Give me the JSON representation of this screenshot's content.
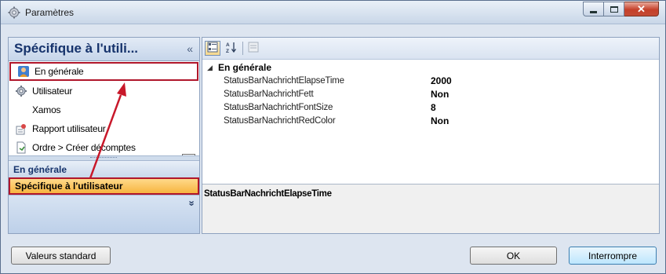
{
  "window": {
    "title": "Paramètres",
    "minimize_glyph": "–",
    "maximize_glyph": "□",
    "close_glyph": "✕"
  },
  "nav": {
    "header_title": "Spécifique à l'utili...",
    "collapse_glyph": "«",
    "items": [
      {
        "label": "En générale",
        "icon": "user-general-icon",
        "selected": true
      },
      {
        "label": "Utilisateur",
        "icon": "gear-icon",
        "selected": false
      },
      {
        "label": "Xamos",
        "icon": "",
        "selected": false
      },
      {
        "label": "Rapport utilisateur",
        "icon": "report-user-icon",
        "selected": false
      },
      {
        "label": "Ordre > Créer décomptes",
        "icon": "document-icon",
        "selected": false
      }
    ],
    "sections": [
      {
        "label": "En générale",
        "active": false
      },
      {
        "label": "Spécifique à l'utilisateur",
        "active": true
      }
    ],
    "overflow_glyph": "»"
  },
  "propgrid": {
    "category": "En générale",
    "rows": [
      {
        "name": "StatusBarNachrichtElapseTime",
        "value": "2000"
      },
      {
        "name": "StatusBarNachrichtFett",
        "value": "Non"
      },
      {
        "name": "StatusBarNachrichtFontSize",
        "value": "8"
      },
      {
        "name": "StatusBarNachrichtRedColor",
        "value": "Non"
      }
    ],
    "description_title": "StatusBarNachrichtElapseTime"
  },
  "footer": {
    "defaults_label": "Valeurs standard",
    "ok_label": "OK",
    "cancel_label": "Interrompre"
  },
  "colors": {
    "highlight_border": "#b0162b",
    "active_section": "#f7b540",
    "accent_text": "#16336c"
  }
}
